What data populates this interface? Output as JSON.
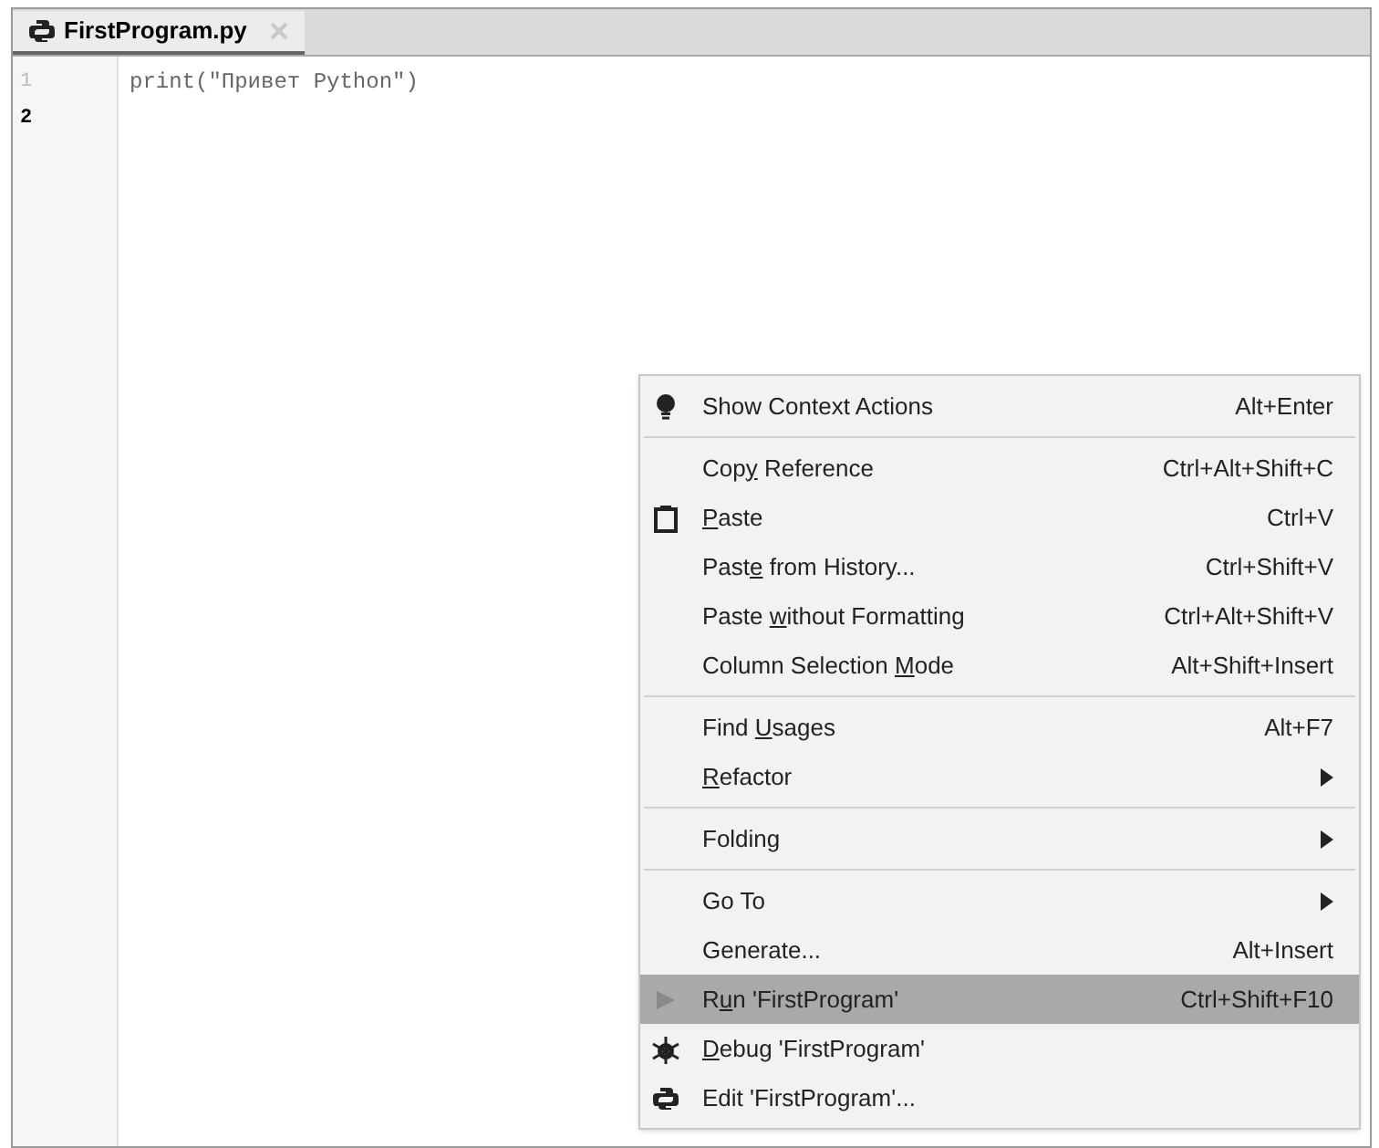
{
  "tab": {
    "label": "FirstProgram.py",
    "selected": true
  },
  "editor": {
    "lines": [
      {
        "number": "1",
        "code": "print(\"Привет Python\")",
        "current": false
      },
      {
        "number": "2",
        "current": true
      }
    ]
  },
  "context_menu": {
    "items": [
      {
        "kind": "item",
        "label": {
          "before": "Show Context Actions"
        },
        "shortcut": "Alt+Enter",
        "submenu": false,
        "selected": false
      },
      {
        "kind": "separator"
      },
      {
        "kind": "item",
        "label": {
          "before": "Cop",
          "mnemonic": "y",
          "after": " Reference"
        },
        "shortcut": "Ctrl+Alt+Shift+C",
        "submenu": false,
        "selected": false
      },
      {
        "kind": "item",
        "label": {
          "mnemonic": "P",
          "after": "aste"
        },
        "shortcut": "Ctrl+V",
        "submenu": false,
        "selected": false
      },
      {
        "kind": "item",
        "label": {
          "before": "Past",
          "mnemonic": "e",
          "after": " from History..."
        },
        "shortcut": "Ctrl+Shift+V",
        "submenu": false,
        "selected": false
      },
      {
        "kind": "item",
        "label": {
          "before": "Paste ",
          "mnemonic": "w",
          "after": "ithout Formatting"
        },
        "shortcut": "Ctrl+Alt+Shift+V",
        "submenu": false,
        "selected": false
      },
      {
        "kind": "item",
        "label": {
          "before": "Column Selection ",
          "mnemonic": "M",
          "after": "ode"
        },
        "shortcut": "Alt+Shift+Insert",
        "submenu": false,
        "selected": false
      },
      {
        "kind": "separator"
      },
      {
        "kind": "item",
        "label": {
          "before": "Find ",
          "mnemonic": "U",
          "after": "sages"
        },
        "shortcut": "Alt+F7",
        "submenu": false,
        "selected": false
      },
      {
        "kind": "item",
        "label": {
          "mnemonic": "R",
          "after": "efactor"
        },
        "submenu": true,
        "selected": false
      },
      {
        "kind": "separator"
      },
      {
        "kind": "item",
        "label": {
          "before": "Folding"
        },
        "submenu": true,
        "selected": false
      },
      {
        "kind": "separator"
      },
      {
        "kind": "item",
        "label": {
          "before": "Go To"
        },
        "submenu": true,
        "selected": false
      },
      {
        "kind": "item",
        "label": {
          "before": "Generate..."
        },
        "shortcut": "Alt+Insert",
        "submenu": false,
        "selected": false
      },
      {
        "kind": "item",
        "label": {
          "before": "R",
          "mnemonic": "u",
          "after": "n 'FirstProgram'"
        },
        "shortcut": "Ctrl+Shift+F10",
        "submenu": false,
        "selected": true
      },
      {
        "kind": "item",
        "label": {
          "mnemonic": "D",
          "after": "ebug 'FirstProgram'"
        },
        "submenu": false,
        "selected": false
      },
      {
        "kind": "item",
        "label": {
          "before": "Edit 'FirstProgram'..."
        },
        "submenu": false,
        "selected": false
      }
    ]
  }
}
